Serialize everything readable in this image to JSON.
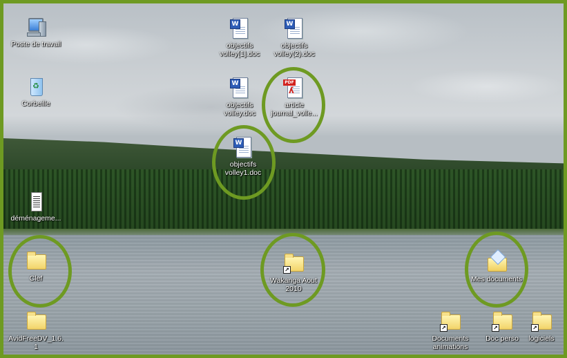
{
  "desktop": {
    "border_color": "#6e9a22",
    "annotation_color": "#6e9a22",
    "icons": [
      {
        "label": "Poste de travail",
        "icon": "computer-icon"
      },
      {
        "label": "Corbeille",
        "icon": "recycle-bin-icon"
      },
      {
        "label": "déménageme...",
        "icon": "text-document-icon"
      },
      {
        "label": "Clef",
        "icon": "folder-icon"
      },
      {
        "label": "AvidFreeDV_1.6.1",
        "icon": "folder-icon"
      },
      {
        "label": "objectifs volley[1].doc",
        "icon": "word-document-icon"
      },
      {
        "label": "objectifs volley(2).doc",
        "icon": "word-document-icon"
      },
      {
        "label": "objectifs volley.doc",
        "icon": "word-document-icon"
      },
      {
        "label": "article journal_volle...",
        "icon": "pdf-document-icon"
      },
      {
        "label": "objectifs volley1.doc",
        "icon": "word-document-icon"
      },
      {
        "label": "Wakanga Aout 2010",
        "icon": "folder-shortcut-icon"
      },
      {
        "label": "Mes documents",
        "icon": "my-documents-icon"
      },
      {
        "label": "Documents animations",
        "icon": "folder-shortcut-icon"
      },
      {
        "label": "Doc perso",
        "icon": "folder-shortcut-icon"
      },
      {
        "label": "logiciels",
        "icon": "folder-shortcut-icon"
      }
    ]
  }
}
